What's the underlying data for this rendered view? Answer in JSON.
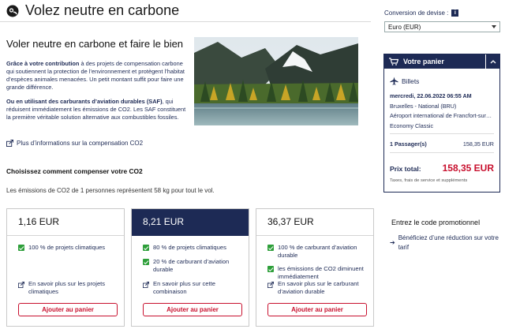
{
  "header": {
    "title": "Volez neutre en carbone"
  },
  "intro": {
    "title": "Voler neutre en carbone et faire le bien",
    "para1_bold": "Grâce à votre contribution",
    "para1_rest": " à des projets de compensation carbone qui soutiennent la protection de l’environnement et protègent l’habitat d’espèces animales menacées. Un petit montant suffit pour faire une grande différence.",
    "para2_bold": "Ou en utilisant des carburants d’aviation durables (SAF)",
    "para2_rest": ", qui réduisent immédiatement les émissions de CO2. Les SAF constituent la première véritable solution alternative aux combustibles fossiles.",
    "more_link": "Plus d’informations sur la compensation CO2"
  },
  "compensation": {
    "title": "Choisissez comment compenser votre CO2",
    "emissions": "Les émissions de CO2 de 1 personnes représentent 58 kg pour tout le vol."
  },
  "cards": [
    {
      "price": "1,16 EUR",
      "options": [
        "100 % de projets climatiques"
      ],
      "info": "En savoir plus sur les projets climatiques",
      "button": "Ajouter au panier"
    },
    {
      "price": "8,21 EUR",
      "options": [
        "80 % de projets climatiques",
        "20 % de carburant d’aviation durable"
      ],
      "info": "En savoir plus sur cette combinaison",
      "button": "Ajouter au panier"
    },
    {
      "price": "36,37 EUR",
      "options": [
        "100 % de carburant d’aviation durable",
        "les émissions de CO2 diminuent immédiatement"
      ],
      "info": "En savoir plus sur le carburant d’aviation durable",
      "button": "Ajouter au panier"
    }
  ],
  "currency": {
    "label": "Conversion de devise :",
    "value": "Euro (EUR)"
  },
  "cart": {
    "title": "Votre panier",
    "tickets_label": "Billets",
    "date": "mercredi, 22.06.2022 06:55 AM",
    "origin": "Bruxelles - National (BRU)",
    "destination": "Aéroport international de Francfort-sur…",
    "cabin": "Economy Classic",
    "passengers_label": "1 Passager(s)",
    "passengers_price": "158,35 EUR",
    "total_label": "Prix total:",
    "total_value": "158,35 EUR",
    "fees_note": "Taxes, frais de service et suppléments"
  },
  "promo": {
    "title": "Entrez le code promotionnel",
    "link": "Bénéficiez d’une réduction sur votre tarif"
  },
  "colors": {
    "navy": "#1d2a55",
    "red": "#c8102e",
    "green": "#2e9f3a"
  }
}
